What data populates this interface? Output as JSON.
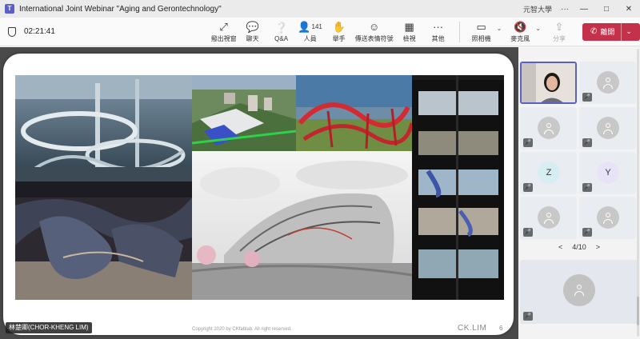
{
  "window": {
    "title": "International Joint Webinar \"Aging and Gerontechnology\"",
    "org": "元智大學",
    "more": "···",
    "minimize": "—",
    "maximize": "□",
    "close": "✕"
  },
  "meeting": {
    "elapsed": "02:21:41"
  },
  "toolbar": {
    "items": [
      {
        "label": "撥出視窗",
        "icon": "⤢"
      },
      {
        "label": "聊天",
        "icon": "💬"
      },
      {
        "label": "Q&A",
        "icon": "❔"
      },
      {
        "label": "人員",
        "icon": "👤",
        "count": "141"
      },
      {
        "label": "舉手",
        "icon": "✋"
      },
      {
        "label": "傳送表情符號",
        "icon": "☺"
      },
      {
        "label": "檢視",
        "icon": "▦"
      },
      {
        "label": "其他",
        "icon": "···"
      }
    ],
    "camera": {
      "label": "照相機",
      "icon": "▭"
    },
    "mic": {
      "label": "麥克風",
      "icon": "🔇"
    },
    "share": {
      "label": "分享",
      "icon": "⇪"
    },
    "leave": {
      "label": "離開",
      "icon": "✆",
      "dropdown": "⌄"
    }
  },
  "slide": {
    "copyright": "Copyright 2020 by CKfablab. All right reserved.",
    "brand": "CK.LIM",
    "page_number": "6"
  },
  "presenter": {
    "name": "林楚卿(CHOR-KHENG LIM)"
  },
  "participants": {
    "tiles": [
      {
        "type": "video"
      },
      {
        "type": "avatar",
        "muted": true
      },
      {
        "type": "avatar",
        "muted": true
      },
      {
        "type": "avatar",
        "muted": true
      },
      {
        "type": "letter",
        "initial": "Z",
        "muted": true,
        "color": "#d6eef2"
      },
      {
        "type": "letter",
        "initial": "Y",
        "muted": true,
        "color": "#e6e4f6"
      },
      {
        "type": "avatar",
        "muted": true
      },
      {
        "type": "avatar",
        "muted": true
      }
    ],
    "pager": {
      "prev": "<",
      "label": "4/10",
      "next": ">"
    },
    "mute_icon": "🎤"
  },
  "colors": {
    "leave": "#c4314b",
    "teams": "#5b5fc7"
  }
}
